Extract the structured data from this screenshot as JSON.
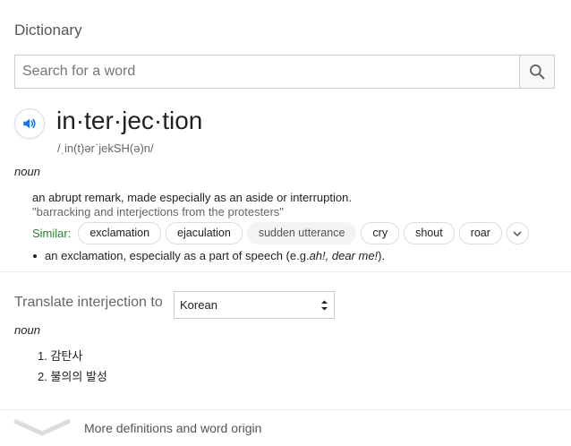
{
  "card": {
    "title": "Dictionary"
  },
  "search": {
    "placeholder": "Search for a word",
    "value": ""
  },
  "entry": {
    "word": "in·ter·jec·tion",
    "phonetic": "/ˌin(t)ərˈjekSH(ə)n/",
    "part_of_speech": "noun",
    "definition_1": {
      "text": "an abrupt remark, made especially as an aside or interruption.",
      "example": "\"barracking and interjections from the protesters\""
    },
    "similar": {
      "label": "Similar:",
      "chips": [
        "exclamation",
        "ejaculation",
        "sudden utterance",
        "cry",
        "shout",
        "roar"
      ]
    },
    "definition_2": {
      "prefix": "an exclamation, especially as a part of speech (e.g. ",
      "example_italic": "ah!, dear me!",
      "suffix": " )."
    }
  },
  "translate": {
    "label": "Translate interjection to",
    "selected_language": "Korean",
    "part_of_speech": "noun",
    "translations": [
      "1. 감탄사",
      "2. 불의의 발성"
    ]
  },
  "footer": {
    "more_label": "More definitions and word origin"
  },
  "colors": {
    "accent_blue": "#1a73e8",
    "similar_green": "#2e7d32"
  },
  "icons": [
    "search-icon",
    "speaker-icon",
    "chevron-down-icon",
    "select-arrows-icon",
    "wide-chevron-down-icon"
  ]
}
